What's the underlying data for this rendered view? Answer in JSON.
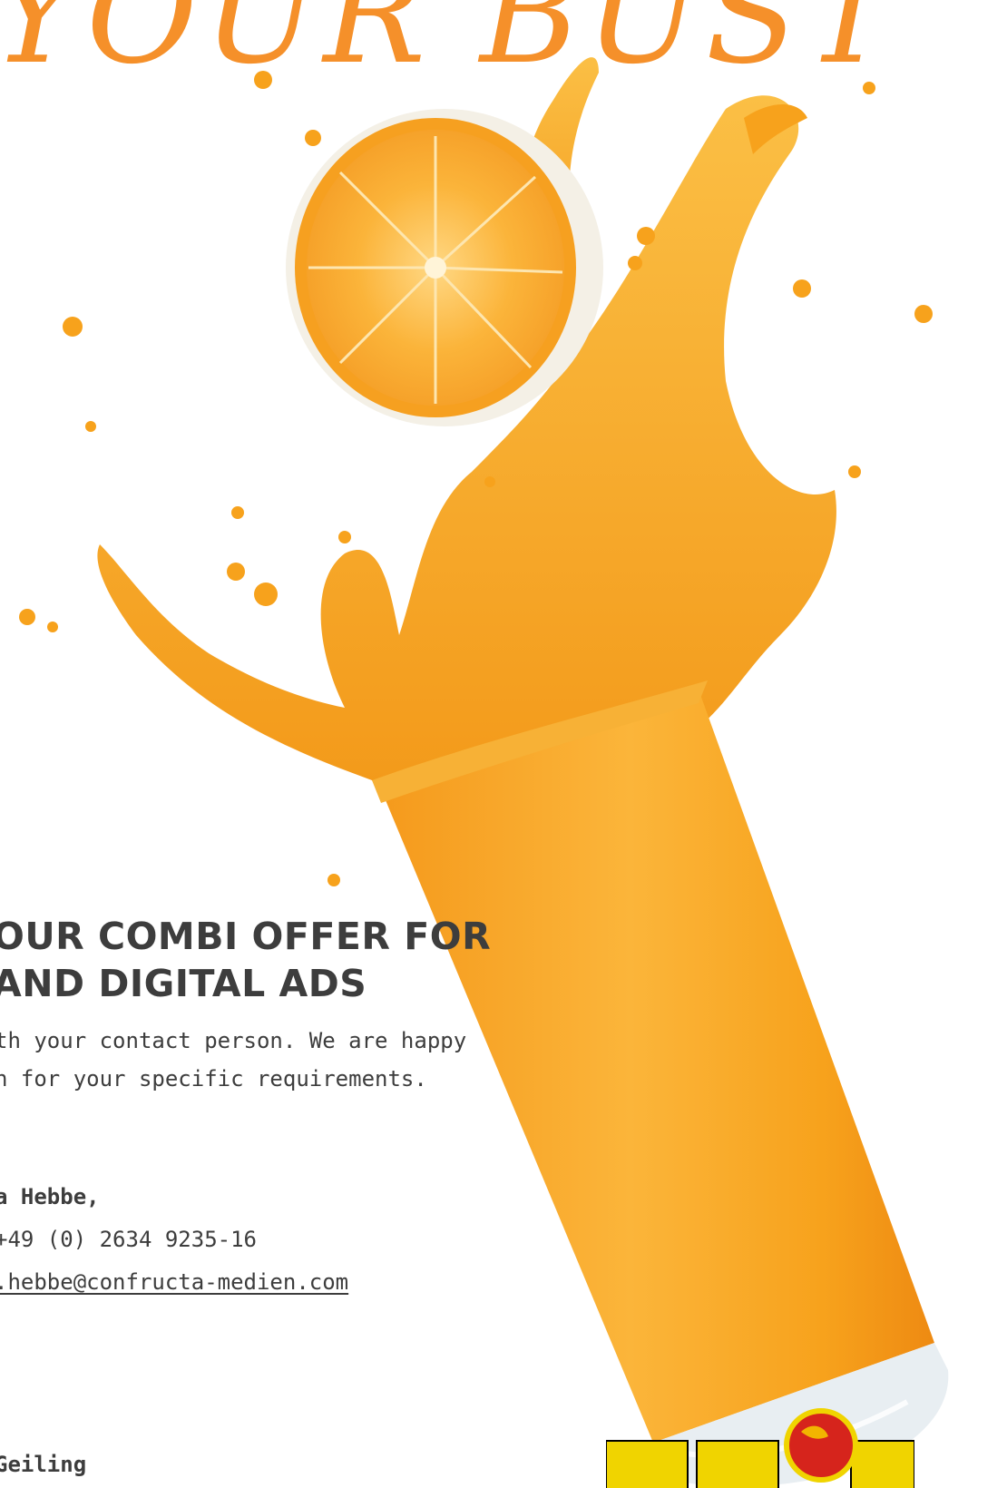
{
  "headline": {
    "line1": "OUR COMBI OFFER FOR",
    "line2": "AND DIGITAL ADS"
  },
  "intro": {
    "line1": "th your contact person. We are happy",
    "line2": "n for your specific requirements."
  },
  "contact": {
    "name": "a Hebbe,",
    "phone": "+49 (0) 2634 9235-16",
    "email": ".hebbe@confructa-medien.com"
  },
  "contact2": {
    "name": "Geiling"
  },
  "title_script": "YOUR BUST",
  "colors": {
    "orange": "#f5902a",
    "juice": "#f7a21c",
    "text": "#3d3d3d",
    "logo_yellow": "#f0d400",
    "logo_red": "#d6241c"
  }
}
